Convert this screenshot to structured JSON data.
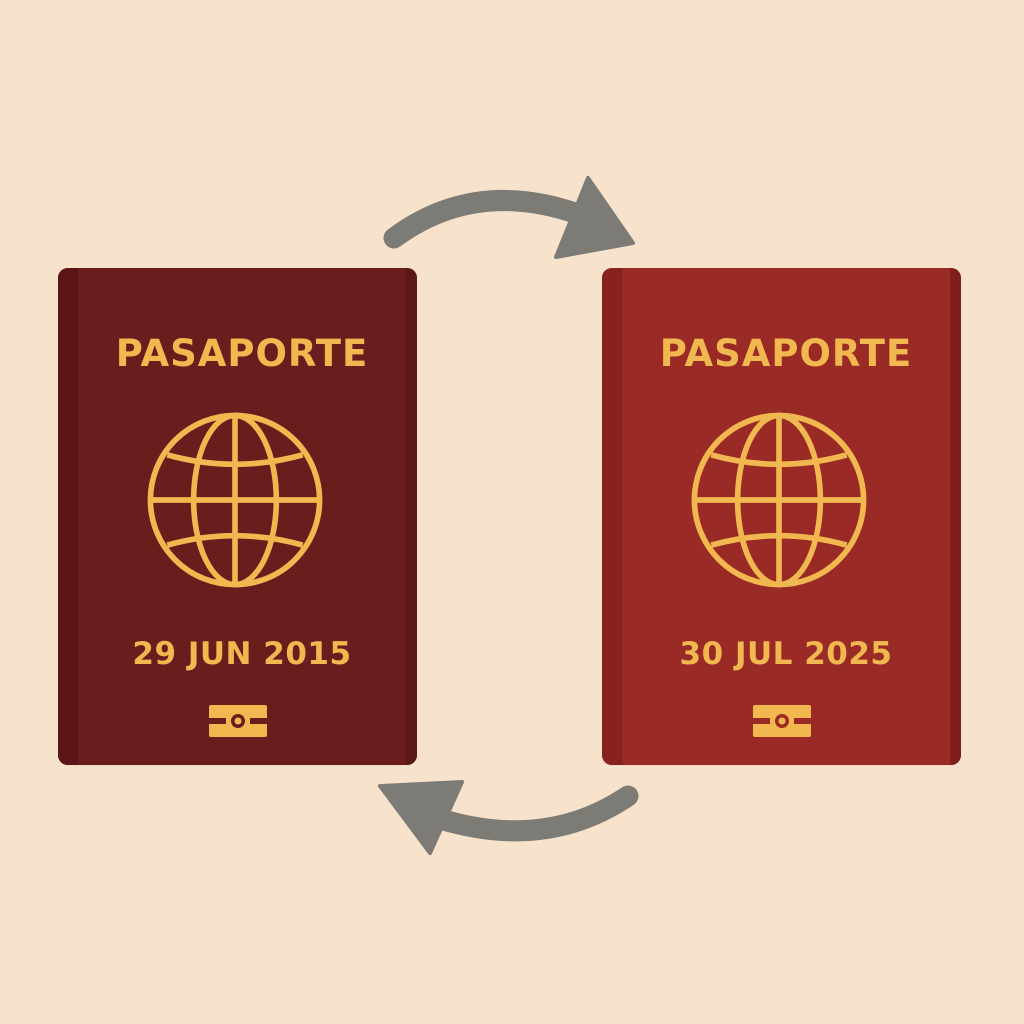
{
  "passports": [
    {
      "title": "PASAPORTE",
      "date": "29 JUN 2015",
      "cover_color": "#6b1c1c",
      "emblem": "globe-icon",
      "chip": "biometric-chip-icon"
    },
    {
      "title": "PASAPORTE",
      "date": "30 JUL 2025",
      "cover_color": "#9a2a26",
      "emblem": "globe-icon",
      "chip": "biometric-chip-icon"
    }
  ],
  "accent_gold": "#f2b850",
  "background": "#f7e3cc",
  "arrows": {
    "top": "curved-arrow-right-icon",
    "bottom": "curved-arrow-left-icon",
    "color": "#7d7b76"
  }
}
